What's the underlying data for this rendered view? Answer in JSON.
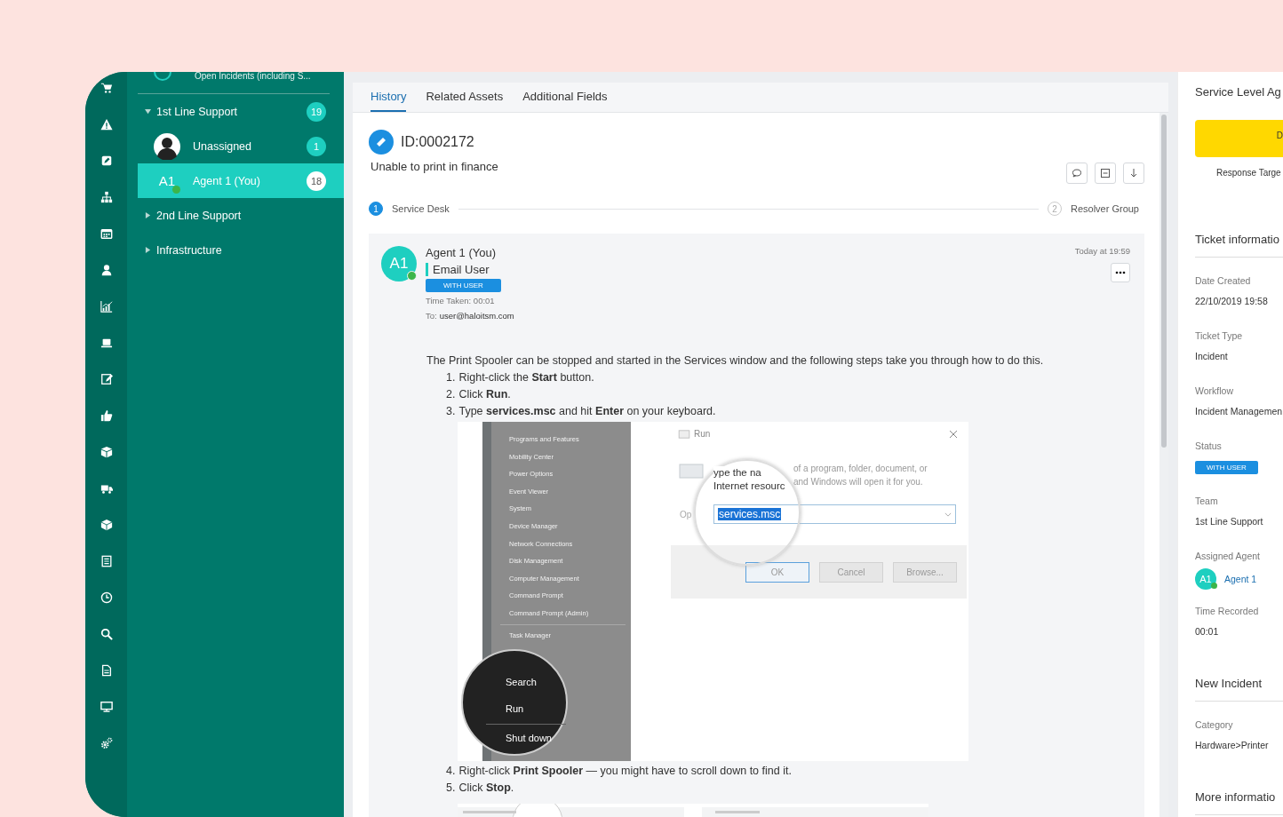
{
  "teams_panel": {
    "header": "Open Incidents (including S...",
    "teams": [
      {
        "label": "1st Line Support",
        "count": "19",
        "expanded": true,
        "children": [
          {
            "kind": "unassigned",
            "label": "Unassigned",
            "count": "1",
            "selected": false
          },
          {
            "kind": "agent",
            "avatar": "A1",
            "online": true,
            "label": "Agent 1 (You)",
            "count": "18",
            "selected": true
          }
        ]
      },
      {
        "label": "2nd Line Support",
        "expanded": false
      },
      {
        "label": "Infrastructure",
        "expanded": false
      }
    ]
  },
  "tabs": [
    {
      "label": "History",
      "selected": true
    },
    {
      "label": "Related Assets",
      "selected": false
    },
    {
      "label": "Additional Fields",
      "selected": false
    }
  ],
  "ticket": {
    "id": "ID:0002172",
    "summary": "Unable to print in finance",
    "steps": [
      {
        "number": "1",
        "label": "Service Desk",
        "selected": true
      },
      {
        "number": "2",
        "label": "Resolver Group",
        "selected": false
      }
    ]
  },
  "action": {
    "avatar": "A1",
    "online": true,
    "author": "Agent 1 (You)",
    "type": "Email User",
    "status": "WITH USER",
    "time_taken": "Time Taken: 00:01",
    "to_label": "To:",
    "to": "user@haloitsm.com",
    "timestamp": "Today at 19:59",
    "intro": "The Print Spooler can be stopped and started in the Services window and the following steps take you through how to do this.",
    "steps_before": [
      {
        "number": "1.",
        "text": "Right-click the **Start** button."
      },
      {
        "number": "2.",
        "text": "Click **Run**."
      },
      {
        "number": "3.",
        "text": "Type **services.msc** and hit **Enter** on your keyboard."
      }
    ],
    "screenshot": {
      "menu_items": [
        "Programs and Features",
        "Mobility Center",
        "Power Options",
        "Event Viewer",
        "System",
        "Device Manager",
        "Network Connections",
        "Disk Management",
        "Computer Management",
        "Command Prompt",
        "Command Prompt (Admin)",
        "Task Manager"
      ],
      "lens_items": [
        "Search",
        "Run",
        "Shut down"
      ],
      "dialog_title": "Run",
      "lens_lines": [
        "ype the na",
        "Internet resourc"
      ],
      "description": [
        "of a program, folder, document, or",
        "and Windows will open it for you."
      ],
      "open_label": "Op",
      "value": "services.msc",
      "buttons": [
        {
          "label": "OK",
          "selected": true
        },
        {
          "label": "Cancel",
          "selected": false
        },
        {
          "label": "Browse...",
          "selected": false
        }
      ]
    },
    "steps_after": [
      {
        "number": "4.",
        "text": "Right-click **Print Spooler** — you might have to scroll down to find it."
      },
      {
        "number": "5.",
        "text": "Click **Stop**."
      }
    ]
  },
  "details_panel": {
    "sla_title": "Service Level Ag",
    "sla_button": "D",
    "sla_caption": "Response Targe",
    "sections": [
      {
        "title": "Ticket informatio",
        "fields": [
          {
            "kind": "text",
            "label": "Date Created",
            "value": "22/10/2019 19:58"
          },
          {
            "kind": "text",
            "label": "Ticket Type",
            "value": "Incident"
          },
          {
            "kind": "text",
            "label": "Workflow",
            "value": "Incident Managemen"
          },
          {
            "kind": "badge",
            "label": "Status",
            "value": "WITH USER"
          },
          {
            "kind": "text",
            "label": "Team",
            "value": "1st Line Support"
          },
          {
            "kind": "agent",
            "label": "Assigned Agent",
            "avatar": "A1",
            "online": true,
            "value": "Agent 1"
          },
          {
            "kind": "text",
            "label": "Time Recorded",
            "value": "00:01"
          }
        ]
      },
      {
        "title": "New Incident",
        "fields": [
          {
            "kind": "text",
            "label": "Category",
            "value": "Hardware>Printer"
          }
        ]
      },
      {
        "title": "More informatio"
      }
    ]
  }
}
